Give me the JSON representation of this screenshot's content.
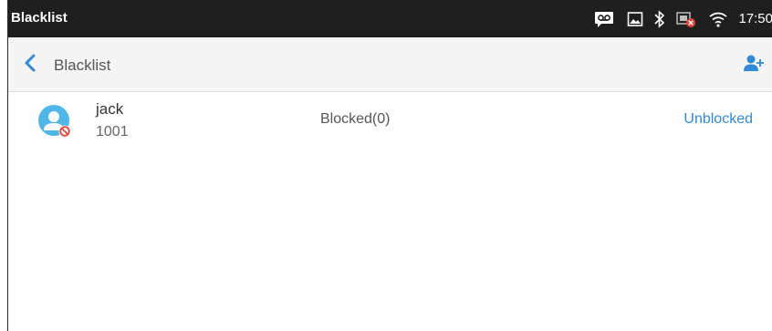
{
  "status_bar": {
    "title": "Blacklist",
    "time": "17:50",
    "icons": [
      "voicemail-icon",
      "image-icon",
      "bluetooth-icon",
      "network-error-icon",
      "wifi-icon"
    ]
  },
  "toolbar": {
    "back_icon": "chevron-left-icon",
    "title": "Blacklist",
    "add_icon": "add-contact-icon"
  },
  "colors": {
    "status_bar_bg": "#1f1f1f",
    "toolbar_bg": "#f5f5f5",
    "accent": "#2e8ad8",
    "avatar": "#4fb6e8",
    "blocked_badge": "#e8403a"
  },
  "contacts": [
    {
      "name": "jack",
      "number": "1001",
      "status": "Blocked(0)",
      "action": "Unblocked"
    }
  ]
}
